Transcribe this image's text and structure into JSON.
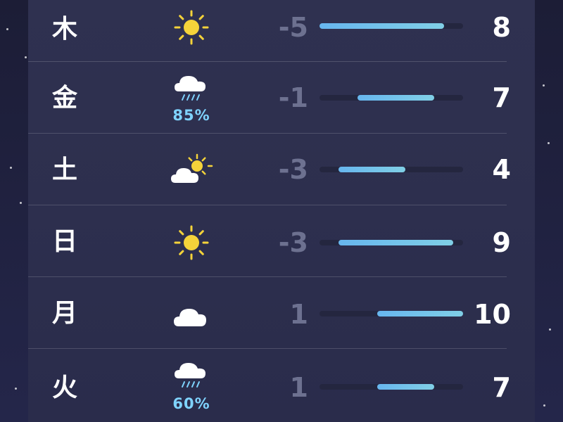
{
  "scale": {
    "min": -5,
    "max": 10
  },
  "colors": {
    "sun": "#f5d33a",
    "cloud": "#ffffff",
    "rain": "#7fd3ff",
    "bar_start": "#67b6ee",
    "bar_end": "#80cfe6"
  },
  "forecast": [
    {
      "day": "木",
      "icon": "sun-icon",
      "precip": "",
      "low": "-5",
      "high": "8",
      "low_val": -5,
      "high_val": 8
    },
    {
      "day": "金",
      "icon": "rain-cloud-icon",
      "precip": "85%",
      "low": "-1",
      "high": "7",
      "low_val": -1,
      "high_val": 7
    },
    {
      "day": "土",
      "icon": "partly-cloudy-icon",
      "precip": "",
      "low": "-3",
      "high": "4",
      "low_val": -3,
      "high_val": 4
    },
    {
      "day": "日",
      "icon": "sun-icon",
      "precip": "",
      "low": "-3",
      "high": "9",
      "low_val": -3,
      "high_val": 9
    },
    {
      "day": "月",
      "icon": "cloud-icon",
      "precip": "",
      "low": "1",
      "high": "10",
      "low_val": 1,
      "high_val": 10
    },
    {
      "day": "火",
      "icon": "rain-cloud-icon",
      "precip": "60%",
      "low": "1",
      "high": "7",
      "low_val": 1,
      "high_val": 7
    }
  ]
}
